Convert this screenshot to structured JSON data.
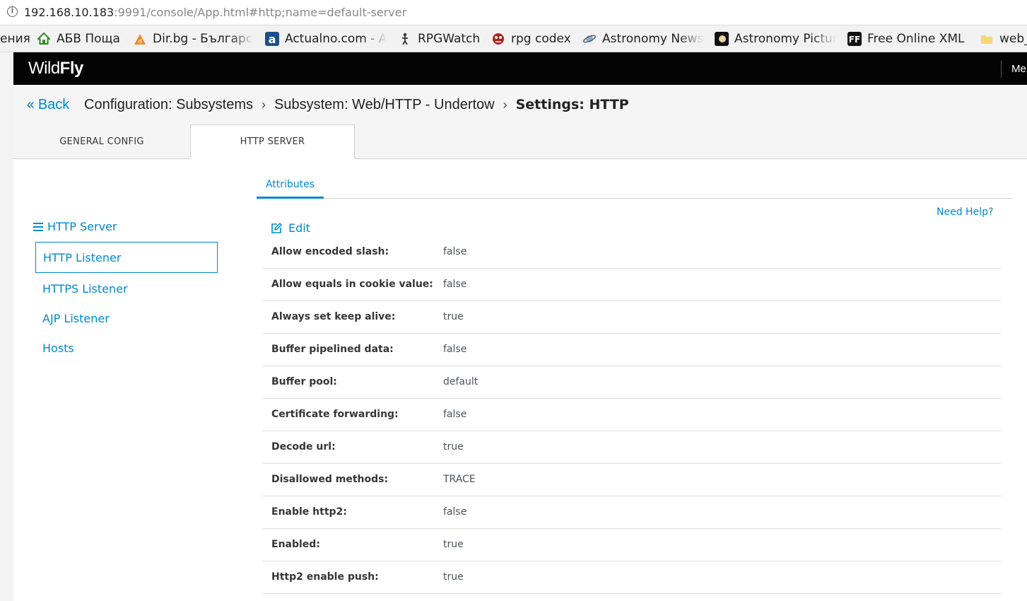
{
  "browser": {
    "url_host": "192.168.10.183",
    "url_rest": ":9991/console/App.html#http;name=default-server",
    "bookmarks": [
      {
        "label": "ения",
        "icon": "none"
      },
      {
        "label": "АБВ Поща",
        "icon": "house-icon"
      },
      {
        "label": "Dir.bg - Българс",
        "icon": "dir-bg-icon"
      },
      {
        "label": "Actualno.com - A",
        "icon": "actualno-icon"
      },
      {
        "label": "RPGWatch",
        "icon": "rpgwatch-icon"
      },
      {
        "label": "rpg codex",
        "icon": "rpg-codex-icon"
      },
      {
        "label": "Astronomy News",
        "icon": "astronomy-news-icon"
      },
      {
        "label": "Astronomy Pictur",
        "icon": "astronomy-picture-icon"
      },
      {
        "label": "Free Online XML",
        "icon": "ff-icon"
      },
      {
        "label": "web_",
        "icon": "folder-icon"
      }
    ]
  },
  "app": {
    "logo_light": "Wild",
    "logo_bold": "Fly",
    "menu_label": "Me"
  },
  "breadcrumb": {
    "back": "Back",
    "items": [
      "Configuration: Subsystems",
      "Subsystem: Web/HTTP - Undertow"
    ],
    "current": "Settings: HTTP"
  },
  "tabs": [
    {
      "label": "GENERAL CONFIG",
      "active": false
    },
    {
      "label": "HTTP SERVER",
      "active": true
    }
  ],
  "sidebar": {
    "heading": "HTTP Server",
    "items": [
      {
        "label": "HTTP Listener",
        "active": true
      },
      {
        "label": "HTTPS Listener",
        "active": false
      },
      {
        "label": "AJP Listener",
        "active": false
      },
      {
        "label": "Hosts",
        "active": false
      }
    ]
  },
  "content": {
    "subtab": "Attributes",
    "help": "Need Help?",
    "edit": "Edit",
    "attributes": [
      {
        "key": "Allow encoded slash:",
        "value": "false"
      },
      {
        "key": "Allow equals in cookie value:",
        "value": "false"
      },
      {
        "key": "Always set keep alive:",
        "value": "true"
      },
      {
        "key": "Buffer pipelined data:",
        "value": "false"
      },
      {
        "key": "Buffer pool:",
        "value": "default"
      },
      {
        "key": "Certificate forwarding:",
        "value": "false"
      },
      {
        "key": "Decode url:",
        "value": "true"
      },
      {
        "key": "Disallowed methods:",
        "value": "TRACE"
      },
      {
        "key": "Enable http2:",
        "value": "false"
      },
      {
        "key": "Enabled:",
        "value": "true"
      },
      {
        "key": "Http2 enable push:",
        "value": "true"
      }
    ]
  },
  "colors": {
    "accent": "#0088ce",
    "topbar": "#030303",
    "panel": "#f5f5f5"
  }
}
